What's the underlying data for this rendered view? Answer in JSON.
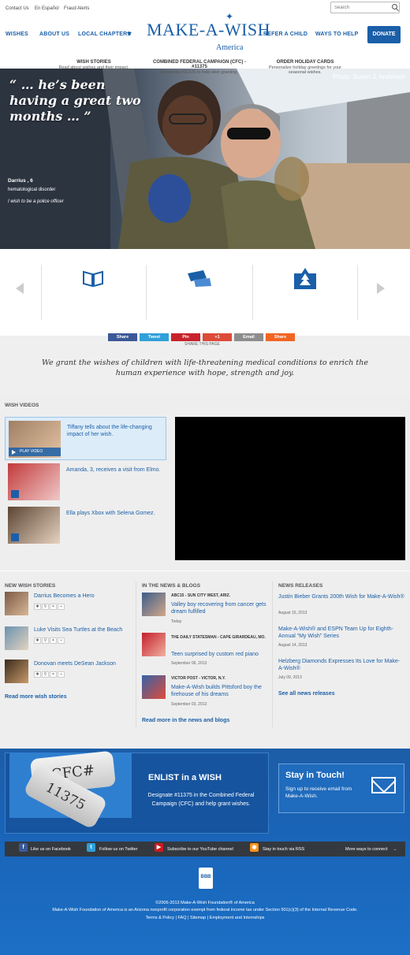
{
  "utility_links": [
    "Contact Us",
    "En Español",
    "Fraud Alerts"
  ],
  "search": {
    "placeholder": "Search"
  },
  "nav": {
    "left": [
      "WISHES",
      "ABOUT US",
      "LOCAL CHAPTERS"
    ],
    "right": [
      "REFER A CHILD",
      "WAYS TO HELP"
    ],
    "donate": "DONATE"
  },
  "logo": {
    "main": "MAKE-A-WISH",
    "sub": "America"
  },
  "hero": {
    "quote": "“ … he’s been having a great two months … ”",
    "photo_credit": "Photo: Susan J. Anderson",
    "name": "Darrius , 6",
    "condition": "hematological disorder",
    "wish": "I wish to be a police officer"
  },
  "carousel": [
    {
      "title": "WISH STORIES",
      "desc": "Read about wishes and their impact."
    },
    {
      "title": "COMBINED FEDERAL CAMPAIGN (CFC) - #11375",
      "desc": "Designate #11375 to help wish granting."
    },
    {
      "title": "ORDER HOLIDAY CARDS",
      "desc": "Personalize holiday greetings for your seasonal wishes."
    }
  ],
  "share": {
    "buttons": [
      "Share",
      "Tweet",
      "Pin",
      "+1",
      "Email",
      "Share"
    ],
    "caption": "SHARE THIS PAGE"
  },
  "mission": "We grant the wishes of children with life-threatening medical conditions to enrich the human experience with hope, strength and joy.",
  "videos": {
    "heading": "WISH VIDEOS",
    "play_label": "PLAY VIDEO",
    "items": [
      {
        "title": "Tiffany tells about the life-changing impact of her wish."
      },
      {
        "title": "Amanda, 3, receives a visit from Elmo."
      },
      {
        "title": "Ella plays Xbox with Selena Gomez."
      }
    ]
  },
  "stories": {
    "heading": "NEW WISH STORIES",
    "items": [
      "Darrius Becomes a Hero",
      "Luke Visits Sea Turtles at the Beach",
      "Donovan meets DeSean Jackson"
    ],
    "more": "Read more wish stories"
  },
  "news": {
    "heading": "IN THE NEWS & BLOGS",
    "items": [
      {
        "source": "ABC15 - SUN CITY WEST, ARIZ.",
        "title": "Valley boy recovering from cancer gets dream fulfilled",
        "date": "Today"
      },
      {
        "source": "THE DAILY STATESMAN - CAPE GIRARDEAU, MO.",
        "title": "Teen surprised by custom red piano",
        "date": "September 06, 2013"
      },
      {
        "source": "VICTOR POST - VICTOR, N.Y.",
        "title": "Make-A-Wish builds Pittsford boy the firehouse of his dreams",
        "date": "September 03, 2013"
      }
    ],
    "more": "Read more in the news and blogs"
  },
  "releases": {
    "heading": "NEWS RELEASES",
    "items": [
      {
        "title": "Justin Bieber Grants 200th Wish for Make-A-Wish®",
        "date": "August 15, 2013"
      },
      {
        "title": "Make-A-Wish® and ESPN Team Up for Eighth-Annual “My Wish” Series",
        "date": "August 14, 2013"
      },
      {
        "title": "Helzberg Diamonds Expresses Its Love for Make-A-Wish®",
        "date": "July 09, 2013"
      }
    ],
    "more": "See all news releases"
  },
  "cfc": {
    "tag1": "CFC#",
    "tag2": "11375",
    "heading": "ENLIST in a WISH",
    "text": "Designate #11375 in the Combined Federal Campaign (CFC) and help grant wishes."
  },
  "stay": {
    "heading": "Stay in Touch!",
    "text": "Sign up to receive email from Make-A-Wish."
  },
  "social": [
    "Like us on Facebook",
    "Follow us on Twitter",
    "Subscribe to our YouTube channel",
    "Stay in touch via RSS",
    "More ways to connect"
  ],
  "footer": {
    "bbb": "BBB",
    "copyright": "©2006-2013 Make-A-Wish Foundation® of America",
    "legal": "Make-A-Wish Foundation of America is an Arizona nonprofit corporation exempt from federal income tax under Section 501(c)(3) of the Internal Revenue Code.",
    "links": [
      "Terms & Policy",
      "FAQ",
      "Sitemap",
      "Employment and Internships"
    ]
  }
}
